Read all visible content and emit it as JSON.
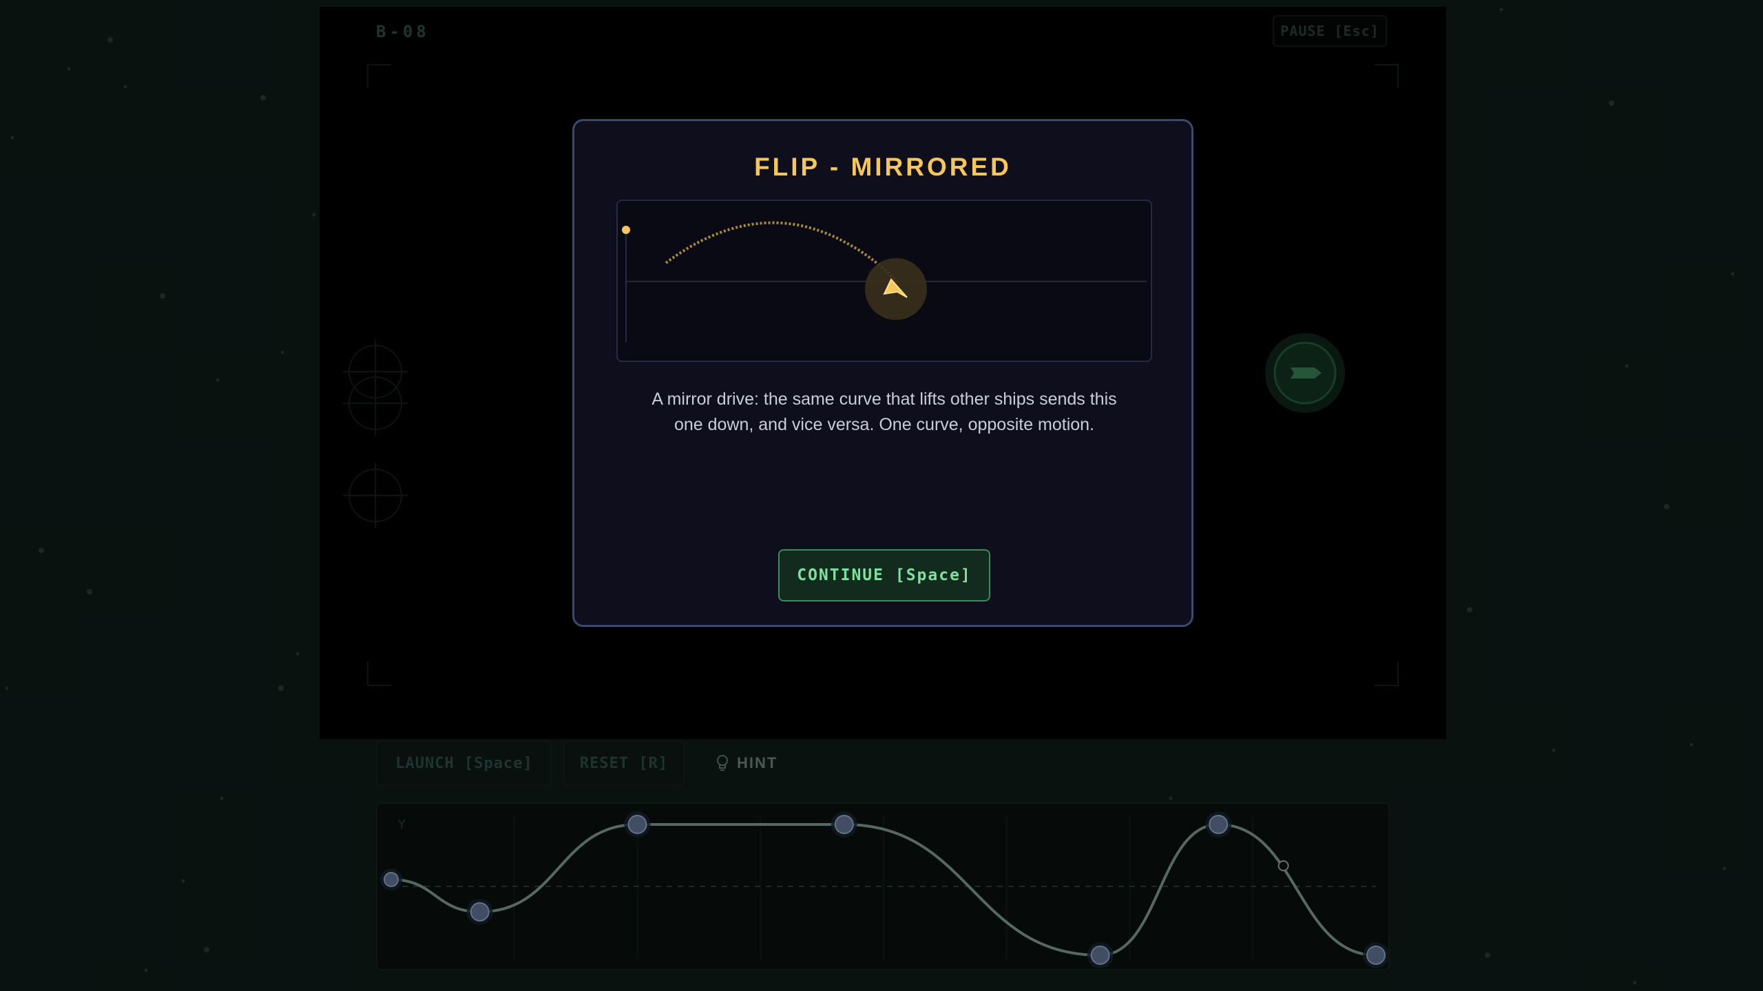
{
  "level": {
    "id": "B-08"
  },
  "pause_button": {
    "label": "PAUSE [Esc]"
  },
  "controls": {
    "launch_label": "LAUNCH [Space]",
    "reset_label": "RESET [R]",
    "hint_label": "HINT",
    "hint_icon": "lightbulb-icon"
  },
  "graph": {
    "axis_label": "Y",
    "nodes": [
      {
        "t": 0.0,
        "y": 0.1
      },
      {
        "t": 0.09,
        "y": -0.37
      },
      {
        "t": 0.25,
        "y": 0.9
      },
      {
        "t": 0.46,
        "y": 0.9
      },
      {
        "t": 0.72,
        "y": -1.0
      },
      {
        "t": 0.84,
        "y": 0.9
      },
      {
        "t": 1.0,
        "y": -1.0
      }
    ],
    "curve_color": "#6a7f78",
    "node_color": "#4f5e78"
  },
  "modal": {
    "title": "FLIP - MIRRORED",
    "description_line1": "A mirror drive: the same curve that lifts other ships sends this",
    "description_line2": "one down, and vice versa. One curve, opposite motion.",
    "continue_label": "CONTINUE [Space]",
    "accent_color": "#f5c65a",
    "ship_icon": "mirrored-ship-icon"
  }
}
